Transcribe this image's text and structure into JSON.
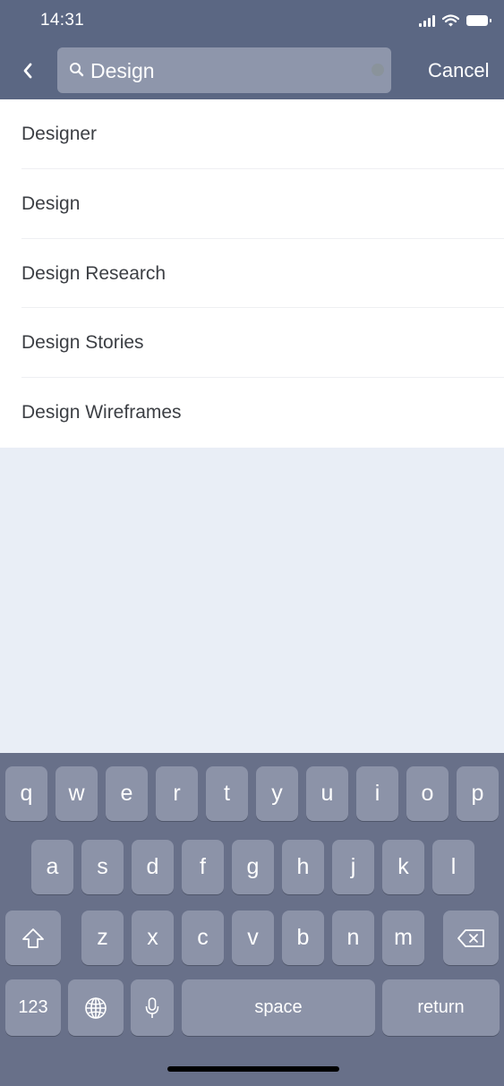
{
  "status_bar": {
    "time": "14:31",
    "icons": [
      "cellular-signal-icon",
      "wifi-icon",
      "battery-icon"
    ]
  },
  "nav": {
    "back_icon": "chevron-left-icon",
    "search": {
      "value": "Design",
      "placeholder": ""
    },
    "cancel_label": "Cancel"
  },
  "results": [
    {
      "label": "Designer"
    },
    {
      "label": "Design"
    },
    {
      "label": "Design Research"
    },
    {
      "label": "Design Stories"
    },
    {
      "label": "Design Wireframes"
    }
  ],
  "keyboard": {
    "row1": [
      "q",
      "w",
      "e",
      "r",
      "t",
      "y",
      "u",
      "i",
      "o",
      "p"
    ],
    "row2": [
      "a",
      "s",
      "d",
      "f",
      "g",
      "h",
      "j",
      "k",
      "l"
    ],
    "row3": [
      "z",
      "x",
      "c",
      "v",
      "b",
      "n",
      "m"
    ],
    "numbers_label": "123",
    "space_label": "space",
    "return_label": "return",
    "shift_icon": "shift-icon",
    "backspace_icon": "backspace-icon",
    "globe_icon": "globe-icon",
    "mic_icon": "microphone-icon"
  },
  "colors": {
    "header": "#5b6783",
    "search_field": "#8e96ab",
    "keyboard_bg": "#687089",
    "key": "#8c93a8",
    "page_bg": "#e9eef6"
  }
}
